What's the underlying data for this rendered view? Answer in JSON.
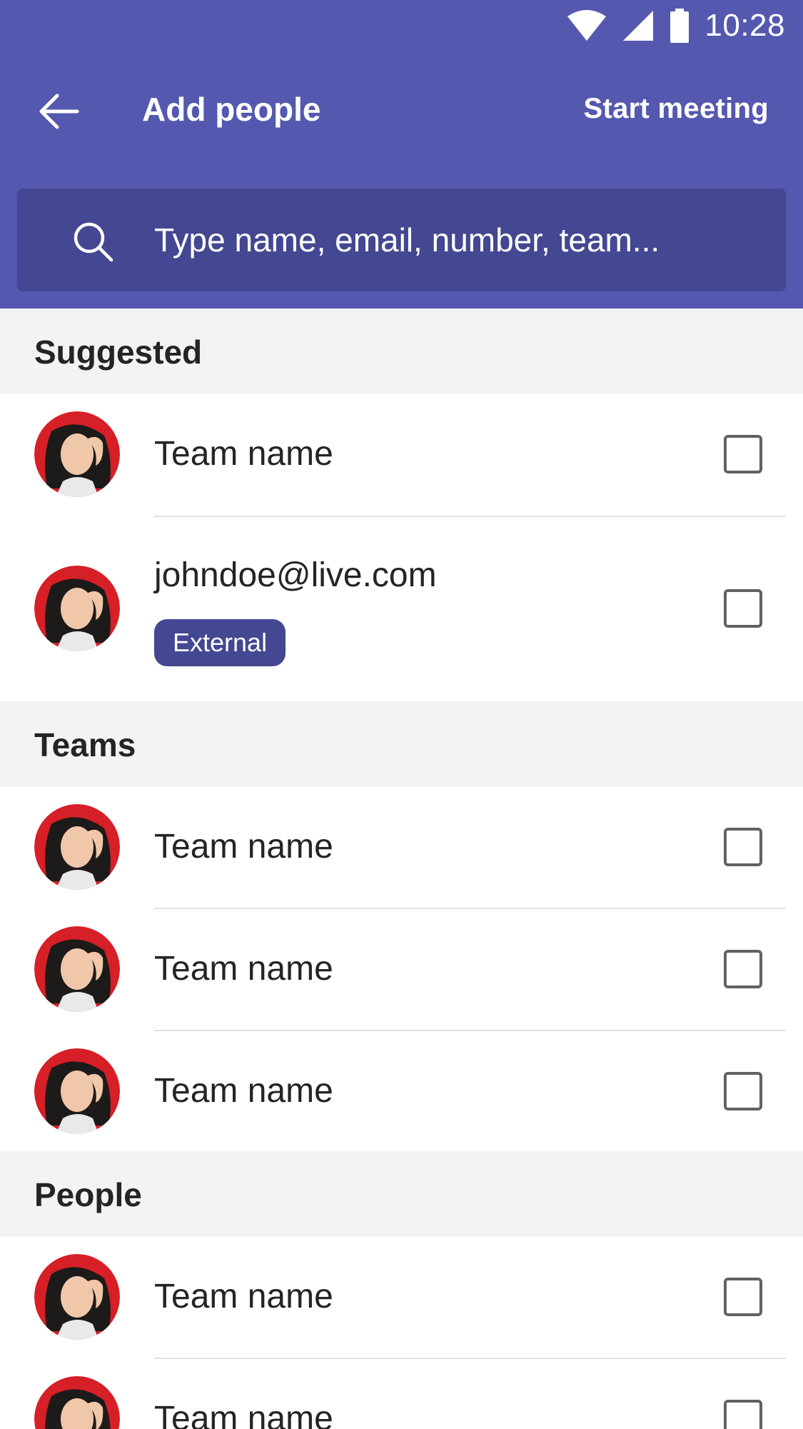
{
  "status_bar": {
    "time": "10:28",
    "icons": [
      "wifi-icon",
      "signal-icon",
      "battery-icon"
    ]
  },
  "app_bar": {
    "title": "Add people",
    "back_icon": "arrow-left-icon",
    "action_label": "Start meeting"
  },
  "search": {
    "placeholder": "Type name, email, number, team...",
    "icon": "search-icon"
  },
  "colors": {
    "header_bg": "#5558af",
    "search_bg": "#444791",
    "section_bg": "#f3f3f3",
    "badge_bg": "#444791"
  },
  "sections": [
    {
      "title": "Suggested",
      "items": [
        {
          "label": "Team name",
          "checked": false
        },
        {
          "label": "johndoe@live.com",
          "badge": "External",
          "checked": false
        }
      ]
    },
    {
      "title": "Teams",
      "items": [
        {
          "label": "Team name",
          "checked": false
        },
        {
          "label": "Team name",
          "checked": false
        },
        {
          "label": "Team name",
          "checked": false
        }
      ]
    },
    {
      "title": "People",
      "items": [
        {
          "label": "Team name",
          "checked": false
        },
        {
          "label": "Team name",
          "checked": false
        }
      ]
    }
  ]
}
